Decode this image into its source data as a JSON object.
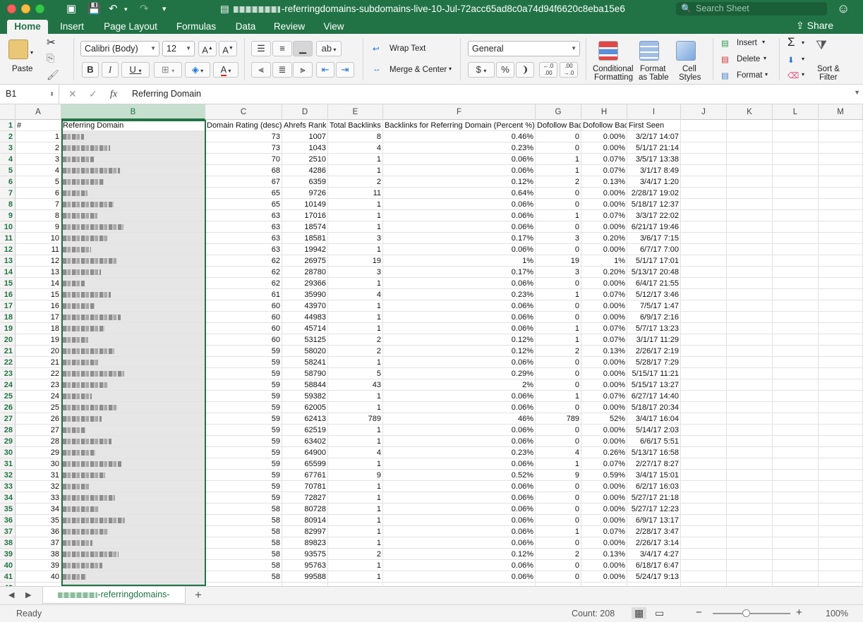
{
  "window": {
    "title_suffix": "-referringdomains-subdomains-live-10-Jul-72acc65ad8c0a74d94f6620c8eba15e6",
    "search_placeholder": "Search Sheet"
  },
  "ribbon_tabs": [
    "Home",
    "Insert",
    "Page Layout",
    "Formulas",
    "Data",
    "Review",
    "View"
  ],
  "share_label": "Share",
  "ribbon": {
    "paste": "Paste",
    "font_name": "Calibri (Body)",
    "font_size": "12",
    "wrap_text": "Wrap Text",
    "merge_center": "Merge & Center",
    "number_format": "General",
    "conditional_formatting": [
      "Conditional",
      "Formatting"
    ],
    "format_as_table": [
      "Format",
      "as Table"
    ],
    "cell_styles": [
      "Cell",
      "Styles"
    ],
    "insert": "Insert",
    "delete": "Delete",
    "format": "Format",
    "sort_filter": [
      "Sort &",
      "Filter"
    ]
  },
  "formula_bar": {
    "name_box": "B1",
    "fx": "fx",
    "content": "Referring Domain"
  },
  "columns": [
    "A",
    "B",
    "C",
    "D",
    "E",
    "F",
    "G",
    "H",
    "I",
    "J",
    "K",
    "L",
    "M"
  ],
  "headers": [
    "#",
    "Referring Domain",
    "Domain Rating (desc)",
    "Ahrefs Rank",
    "Total Backlinks",
    "Backlinks for Referring Domain (Percent %)",
    "Dofollow Backlinks",
    "Dofollow Backlinks (Percent %)",
    "First Seen"
  ],
  "rows": [
    [
      "1",
      "73",
      "1007",
      "8",
      "0.46%",
      "0",
      "0.00%",
      "3/2/17 14:07"
    ],
    [
      "2",
      "73",
      "1043",
      "4",
      "0.23%",
      "0",
      "0.00%",
      "5/1/17 21:14"
    ],
    [
      "3",
      "70",
      "2510",
      "1",
      "0.06%",
      "1",
      "0.07%",
      "3/5/17 13:38"
    ],
    [
      "4",
      "68",
      "4286",
      "1",
      "0.06%",
      "1",
      "0.07%",
      "3/1/17 8:49"
    ],
    [
      "5",
      "67",
      "6359",
      "2",
      "0.12%",
      "2",
      "0.13%",
      "3/4/17 1:20"
    ],
    [
      "6",
      "65",
      "9726",
      "11",
      "0.64%",
      "0",
      "0.00%",
      "2/28/17 19:02"
    ],
    [
      "7",
      "65",
      "10149",
      "1",
      "0.06%",
      "0",
      "0.00%",
      "5/18/17 12:37"
    ],
    [
      "8",
      "63",
      "17016",
      "1",
      "0.06%",
      "1",
      "0.07%",
      "3/3/17 22:02"
    ],
    [
      "9",
      "63",
      "18574",
      "1",
      "0.06%",
      "0",
      "0.00%",
      "6/21/17 19:46"
    ],
    [
      "10",
      "63",
      "18581",
      "3",
      "0.17%",
      "3",
      "0.20%",
      "3/6/17 7:15"
    ],
    [
      "11",
      "63",
      "19942",
      "1",
      "0.06%",
      "0",
      "0.00%",
      "6/7/17 7:00"
    ],
    [
      "12",
      "62",
      "26975",
      "19",
      "1%",
      "19",
      "1%",
      "5/1/17 17:01"
    ],
    [
      "13",
      "62",
      "28780",
      "3",
      "0.17%",
      "3",
      "0.20%",
      "5/13/17 20:48"
    ],
    [
      "14",
      "62",
      "29366",
      "1",
      "0.06%",
      "0",
      "0.00%",
      "6/4/17 21:55"
    ],
    [
      "15",
      "61",
      "35990",
      "4",
      "0.23%",
      "1",
      "0.07%",
      "5/12/17 3:46"
    ],
    [
      "16",
      "60",
      "43970",
      "1",
      "0.06%",
      "0",
      "0.00%",
      "7/5/17 1:47"
    ],
    [
      "17",
      "60",
      "44983",
      "1",
      "0.06%",
      "0",
      "0.00%",
      "6/9/17 2:16"
    ],
    [
      "18",
      "60",
      "45714",
      "1",
      "0.06%",
      "1",
      "0.07%",
      "5/7/17 13:23"
    ],
    [
      "19",
      "60",
      "53125",
      "2",
      "0.12%",
      "1",
      "0.07%",
      "3/1/17 11:29"
    ],
    [
      "20",
      "59",
      "58020",
      "2",
      "0.12%",
      "2",
      "0.13%",
      "2/26/17 2:19"
    ],
    [
      "21",
      "59",
      "58241",
      "1",
      "0.06%",
      "0",
      "0.00%",
      "5/28/17 7:29"
    ],
    [
      "22",
      "59",
      "58790",
      "5",
      "0.29%",
      "0",
      "0.00%",
      "5/15/17 11:21"
    ],
    [
      "23",
      "59",
      "58844",
      "43",
      "2%",
      "0",
      "0.00%",
      "5/15/17 13:27"
    ],
    [
      "24",
      "59",
      "59382",
      "1",
      "0.06%",
      "1",
      "0.07%",
      "6/27/17 14:40"
    ],
    [
      "25",
      "59",
      "62005",
      "1",
      "0.06%",
      "0",
      "0.00%",
      "5/18/17 20:34"
    ],
    [
      "26",
      "59",
      "62413",
      "789",
      "46%",
      "789",
      "52%",
      "3/4/17 16:04"
    ],
    [
      "27",
      "59",
      "62519",
      "1",
      "0.06%",
      "0",
      "0.00%",
      "5/14/17 2:03"
    ],
    [
      "28",
      "59",
      "63402",
      "1",
      "0.06%",
      "0",
      "0.00%",
      "6/6/17 5:51"
    ],
    [
      "29",
      "59",
      "64900",
      "4",
      "0.23%",
      "4",
      "0.26%",
      "5/13/17 16:58"
    ],
    [
      "30",
      "59",
      "65599",
      "1",
      "0.06%",
      "1",
      "0.07%",
      "2/27/17 8:27"
    ],
    [
      "31",
      "59",
      "67761",
      "9",
      "0.52%",
      "9",
      "0.59%",
      "3/4/17 15:01"
    ],
    [
      "32",
      "59",
      "70781",
      "1",
      "0.06%",
      "0",
      "0.00%",
      "6/2/17 16:03"
    ],
    [
      "33",
      "59",
      "72827",
      "1",
      "0.06%",
      "0",
      "0.00%",
      "5/27/17 21:18"
    ],
    [
      "34",
      "58",
      "80728",
      "1",
      "0.06%",
      "0",
      "0.00%",
      "5/27/17 12:23"
    ],
    [
      "35",
      "58",
      "80914",
      "1",
      "0.06%",
      "0",
      "0.00%",
      "6/9/17 13:17"
    ],
    [
      "36",
      "58",
      "82997",
      "1",
      "0.06%",
      "1",
      "0.07%",
      "2/28/17 3:47"
    ],
    [
      "37",
      "58",
      "89823",
      "1",
      "0.06%",
      "0",
      "0.00%",
      "2/26/17 3:14"
    ],
    [
      "38",
      "58",
      "93575",
      "2",
      "0.12%",
      "2",
      "0.13%",
      "3/4/17 4:27"
    ],
    [
      "39",
      "58",
      "95763",
      "1",
      "0.06%",
      "0",
      "0.00%",
      "6/18/17 6:47"
    ],
    [
      "40",
      "58",
      "99588",
      "1",
      "0.06%",
      "0",
      "0.00%",
      "5/24/17 9:13"
    ]
  ],
  "sheet_tab": "-referringdomains-",
  "add_sheet": "+",
  "status": {
    "ready": "Ready",
    "count": "Count: 208",
    "zoom": "100%"
  }
}
